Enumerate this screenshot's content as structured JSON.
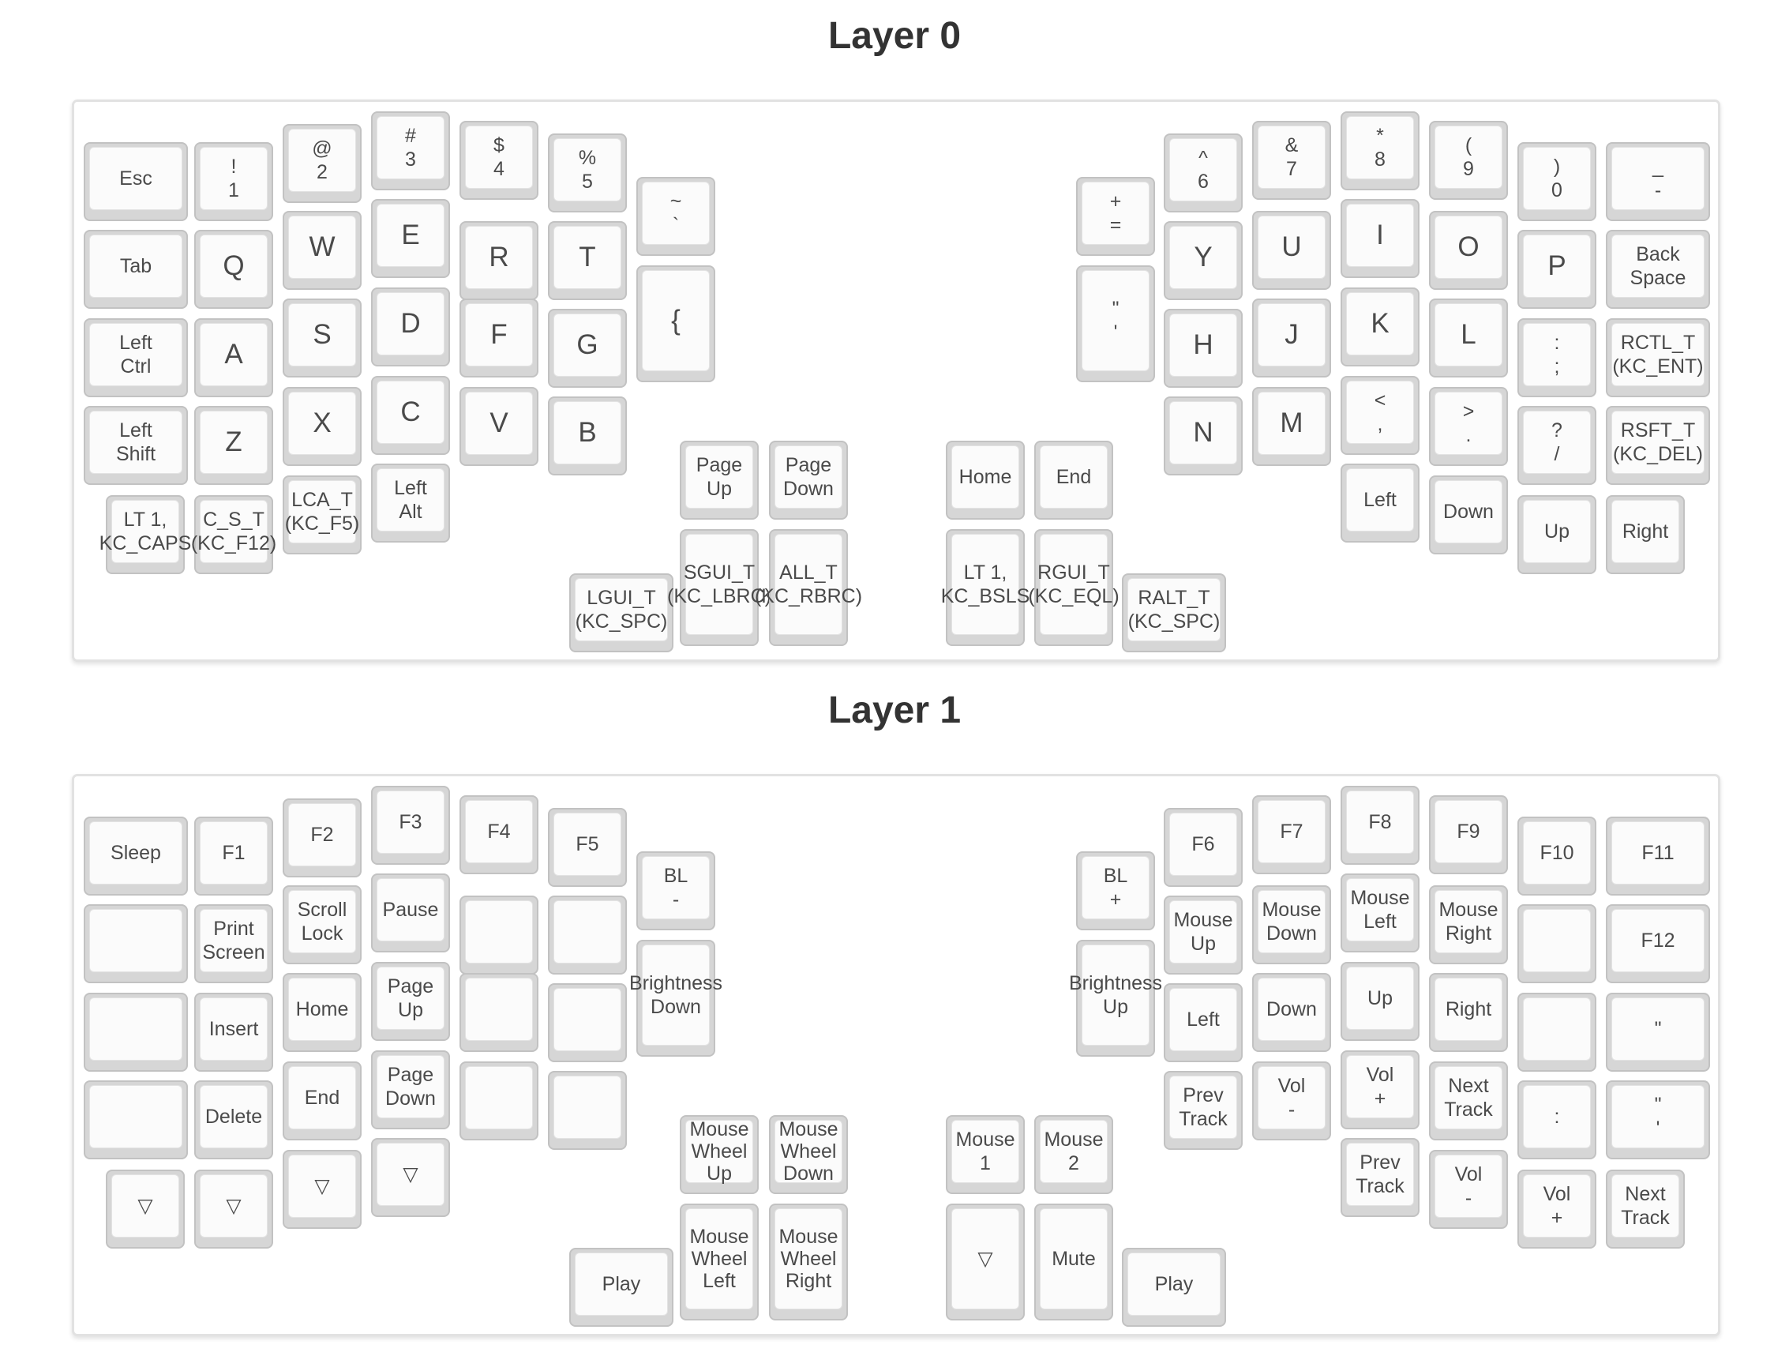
{
  "layers": [
    {
      "title": "Layer 0",
      "keys": [
        [
          "Esc"
        ],
        [
          "!",
          "1"
        ],
        [
          "@",
          "2"
        ],
        [
          "#",
          "3"
        ],
        [
          "$",
          "4"
        ],
        [
          "%",
          "5"
        ],
        [
          "~",
          "`"
        ],
        [
          "Tab"
        ],
        [
          "Q"
        ],
        [
          "W"
        ],
        [
          "E"
        ],
        [
          "R"
        ],
        [
          "T"
        ],
        [
          "{"
        ],
        [
          "Left",
          "Ctrl"
        ],
        [
          "A"
        ],
        [
          "S"
        ],
        [
          "D"
        ],
        [
          "F"
        ],
        [
          "G"
        ],
        [
          "Left",
          "Shift"
        ],
        [
          "Z"
        ],
        [
          "X"
        ],
        [
          "C"
        ],
        [
          "V"
        ],
        [
          "B"
        ],
        [
          "LT 1,",
          "KC_CAPS"
        ],
        [
          "C_S_T",
          "(KC_F12)"
        ],
        [
          "LCA_T",
          "(KC_F5)"
        ],
        [
          "Left",
          "Alt"
        ],
        [
          "Page",
          "Up"
        ],
        [
          "Page",
          "Down"
        ],
        [
          "LGUI_T",
          "(KC_SPC)"
        ],
        [
          "SGUI_T",
          "(KC_LBRC)"
        ],
        [
          "ALL_T",
          "(KC_RBRC)"
        ],
        [
          "+",
          "="
        ],
        [
          "^",
          "6"
        ],
        [
          "&",
          "7"
        ],
        [
          "*",
          "8"
        ],
        [
          "(",
          "9"
        ],
        [
          ")",
          "0"
        ],
        [
          "_",
          "-"
        ],
        [
          "\"",
          "'"
        ],
        [
          "Y"
        ],
        [
          "U"
        ],
        [
          "I"
        ],
        [
          "O"
        ],
        [
          "P"
        ],
        [
          "Back",
          "Space"
        ],
        [
          "H"
        ],
        [
          "J"
        ],
        [
          "K"
        ],
        [
          "L"
        ],
        [
          ":",
          ";"
        ],
        [
          "RCTL_T",
          "(KC_ENT)"
        ],
        [
          "N"
        ],
        [
          "M"
        ],
        [
          "<",
          ","
        ],
        [
          ">",
          "."
        ],
        [
          "?",
          "/"
        ],
        [
          "RSFT_T",
          "(KC_DEL)"
        ],
        [
          "Left"
        ],
        [
          "Down"
        ],
        [
          "Up"
        ],
        [
          "Right"
        ],
        [
          "Home"
        ],
        [
          "End"
        ],
        [
          "LT 1,",
          "KC_BSLS"
        ],
        [
          "RGUI_T",
          "(KC_EQL)"
        ],
        [
          "RALT_T",
          "(KC_SPC)"
        ]
      ]
    },
    {
      "title": "Layer 1",
      "keys": [
        [
          "Sleep"
        ],
        [
          "F1"
        ],
        [
          "F2"
        ],
        [
          "F3"
        ],
        [
          "F4"
        ],
        [
          "F5"
        ],
        [
          "BL",
          "-"
        ],
        [
          ""
        ],
        [
          "Print",
          "Screen"
        ],
        [
          "Scroll",
          "Lock"
        ],
        [
          "Pause"
        ],
        [
          ""
        ],
        [
          ""
        ],
        [
          "Brightness",
          "Down"
        ],
        [
          ""
        ],
        [
          "Insert"
        ],
        [
          "Home"
        ],
        [
          "Page",
          "Up"
        ],
        [
          ""
        ],
        [
          ""
        ],
        [
          ""
        ],
        [
          "Delete"
        ],
        [
          "End"
        ],
        [
          "Page",
          "Down"
        ],
        [
          ""
        ],
        [
          ""
        ],
        [
          "▽"
        ],
        [
          "▽"
        ],
        [
          "▽"
        ],
        [
          "▽"
        ],
        [
          "Mouse",
          "Wheel",
          "Up"
        ],
        [
          "Mouse",
          "Wheel",
          "Down"
        ],
        [
          "Play"
        ],
        [
          "Mouse",
          "Wheel",
          "Left"
        ],
        [
          "Mouse",
          "Wheel",
          "Right"
        ],
        [
          "BL",
          "+"
        ],
        [
          "F6"
        ],
        [
          "F7"
        ],
        [
          "F8"
        ],
        [
          "F9"
        ],
        [
          "F10"
        ],
        [
          "F11"
        ],
        [
          "Brightness",
          "Up"
        ],
        [
          "Mouse",
          "Up"
        ],
        [
          "Mouse",
          "Down"
        ],
        [
          "Mouse",
          "Left"
        ],
        [
          "Mouse",
          "Right"
        ],
        [
          ""
        ],
        [
          "F12"
        ],
        [
          "Left"
        ],
        [
          "Down"
        ],
        [
          "Up"
        ],
        [
          "Right"
        ],
        [
          ""
        ],
        [
          "\""
        ],
        [
          "Prev",
          "Track"
        ],
        [
          "Vol",
          "-"
        ],
        [
          "Vol",
          "+"
        ],
        [
          "Next",
          "Track"
        ],
        [
          ":"
        ],
        [
          "\"",
          "'"
        ],
        [
          "Prev",
          "Track"
        ],
        [
          "Vol",
          "-"
        ],
        [
          "Vol",
          "+"
        ],
        [
          "Next",
          "Track"
        ],
        [
          "Mouse",
          "1"
        ],
        [
          "Mouse",
          "2"
        ],
        [
          "▽"
        ],
        [
          "Mute"
        ],
        [
          "Play"
        ]
      ]
    }
  ]
}
